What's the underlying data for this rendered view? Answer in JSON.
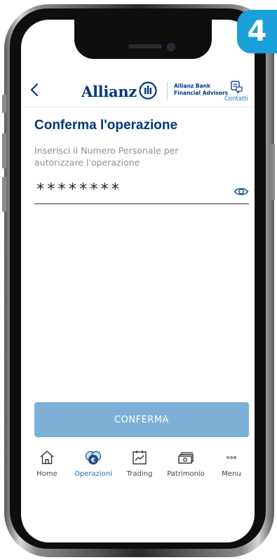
{
  "step_badge": "4",
  "header": {
    "brand": "Allianz",
    "subbrand_line1": "Allianz Bank",
    "subbrand_line2": "Financial Advisors",
    "contact_label": "Contatti"
  },
  "main": {
    "title": "Conferma l'operazione",
    "hint": "Inserisci il Numero Personale per autorizzare l'operazione",
    "password_value": "********",
    "confirm_label": "CONFERMA"
  },
  "tabbar": {
    "items": [
      {
        "label": "Home",
        "icon": "home-icon"
      },
      {
        "label": "Operazioni",
        "icon": "operations-icon"
      },
      {
        "label": "Trading",
        "icon": "trading-icon"
      },
      {
        "label": "Patrimonio",
        "icon": "wealth-icon"
      },
      {
        "label": "Menu",
        "icon": "more-icon"
      }
    ],
    "active": "Operazioni"
  },
  "colors": {
    "brand": "#003781",
    "button": "#7db0d6",
    "badge": "#1a9fd8",
    "active_tab": "#1a6fb8"
  }
}
